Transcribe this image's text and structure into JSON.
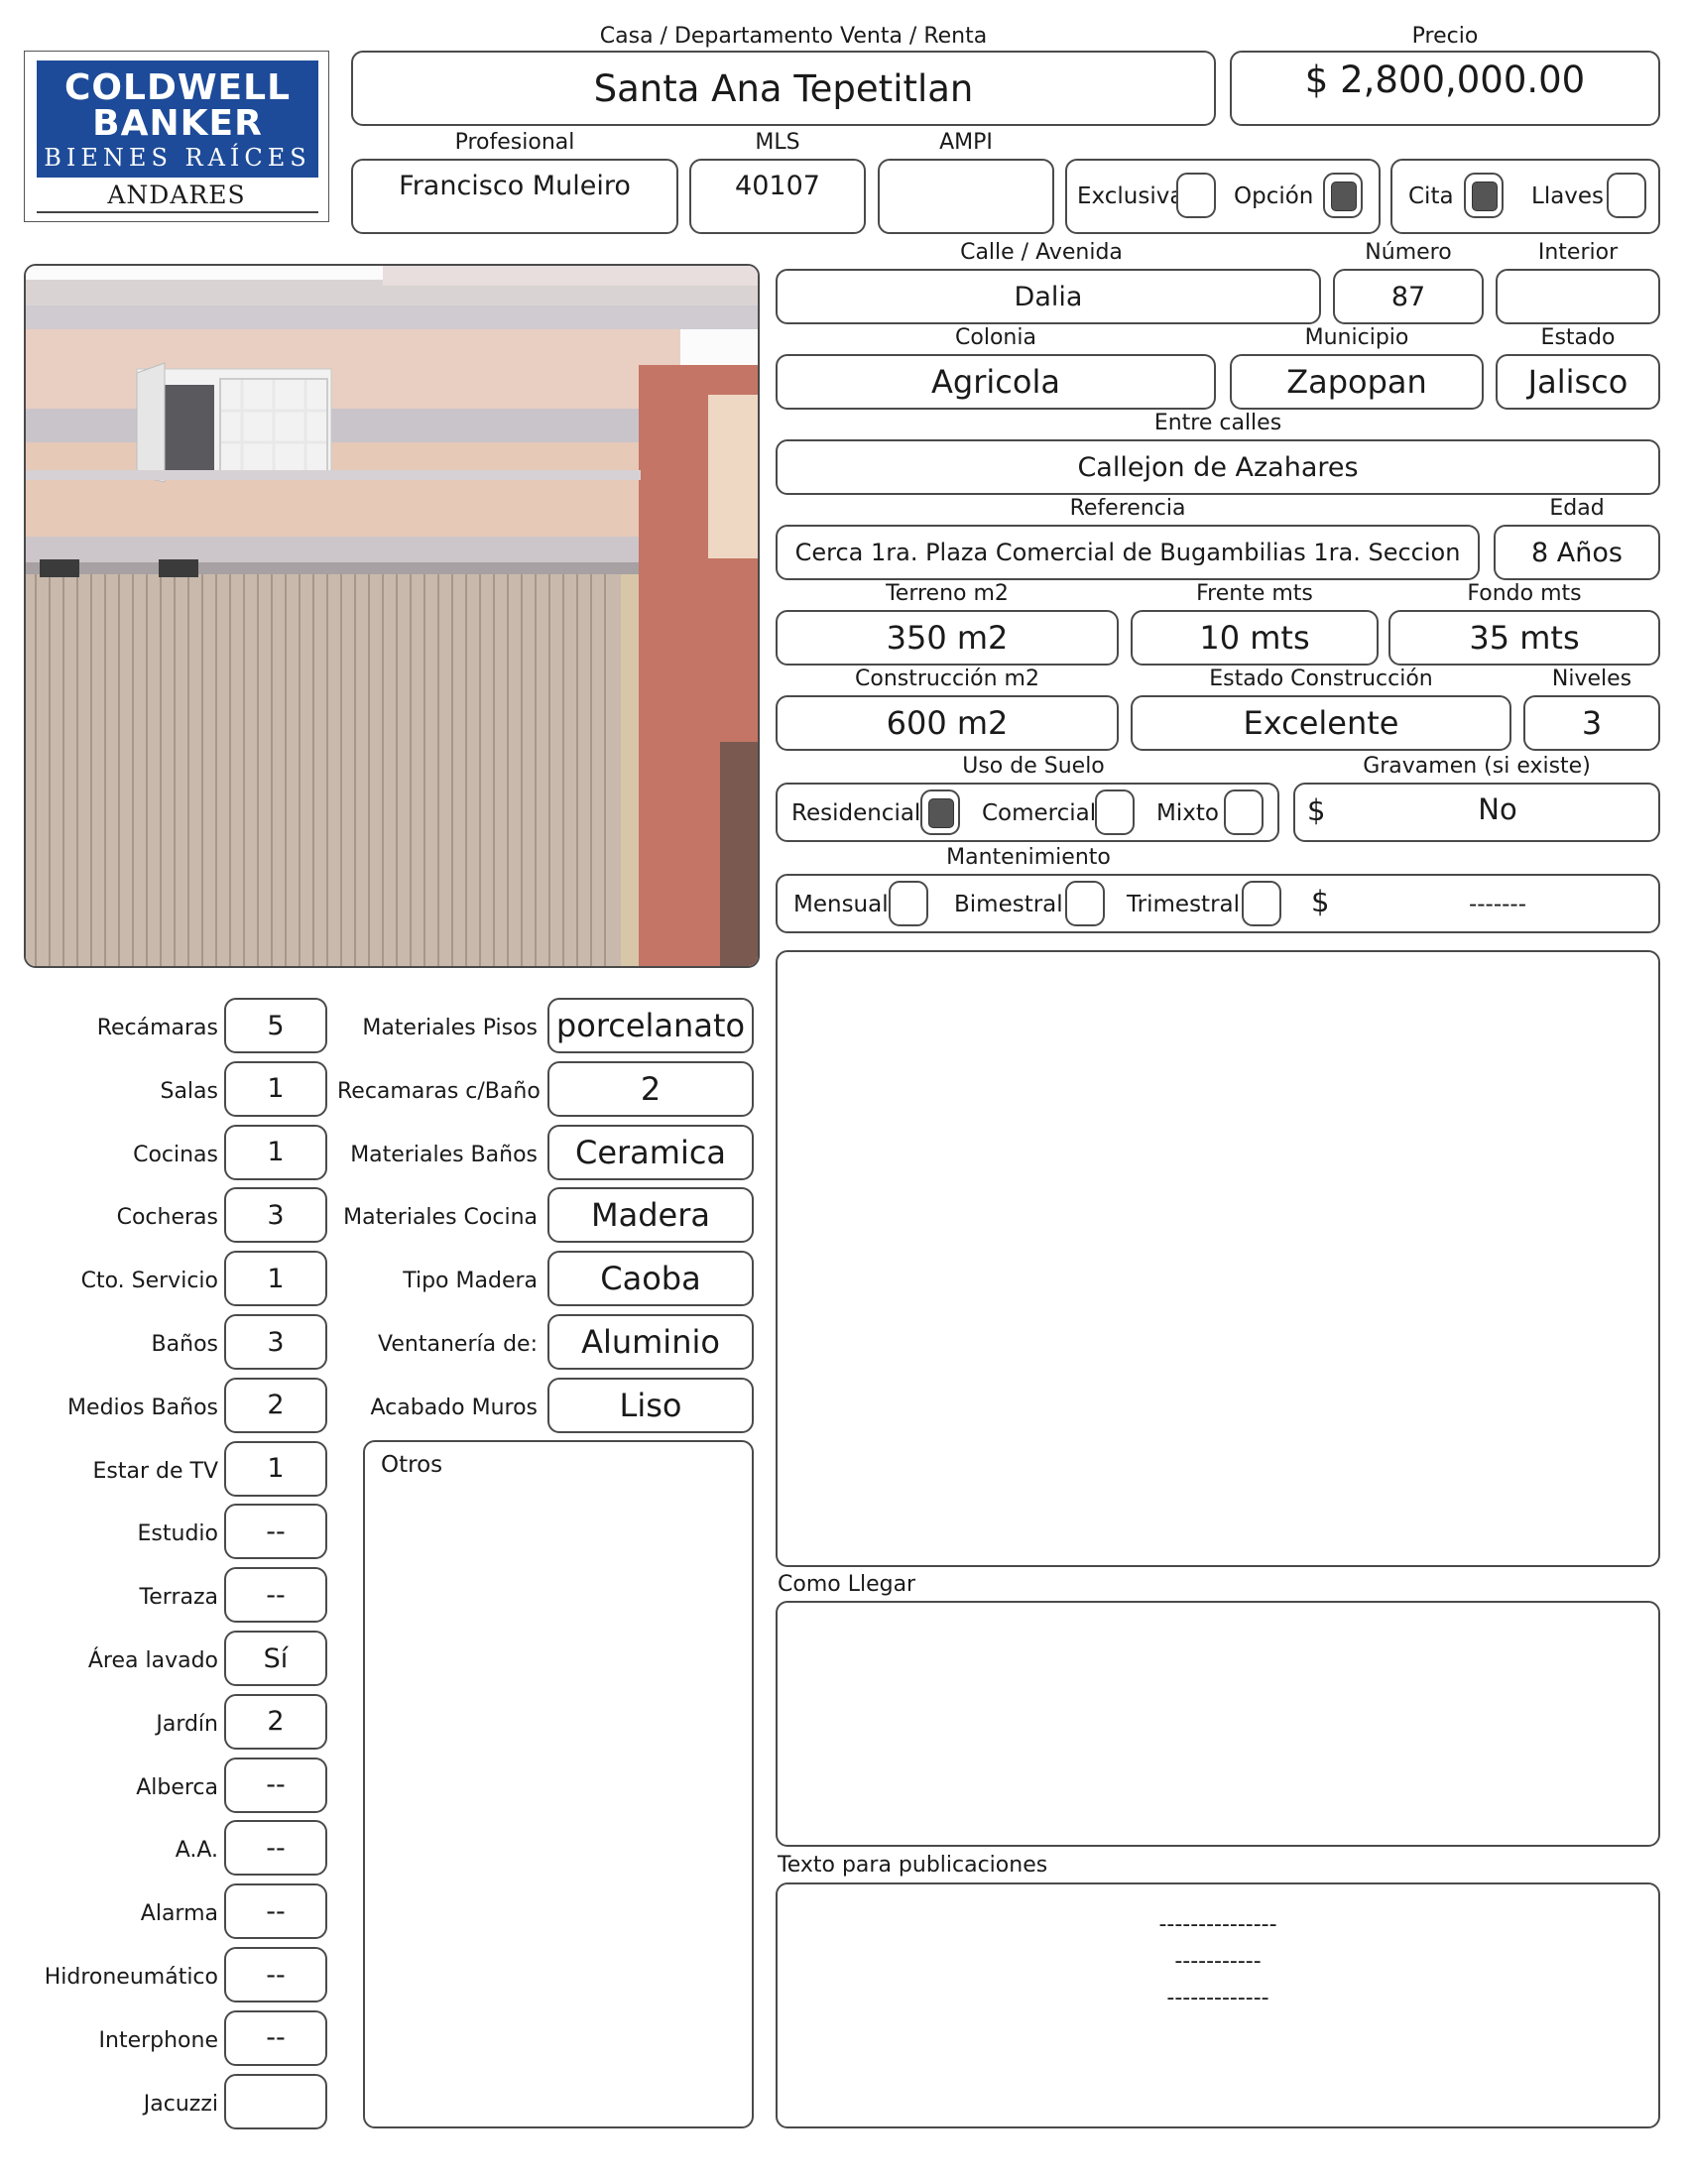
{
  "logo": {
    "line1": "COLDWELL",
    "line2": "BANKER",
    "line3": "BIENES RAÍCES",
    "sub": "ANDARES",
    "brand_color": "#1d4b99"
  },
  "header": {
    "type_label": "Casa / Departamento   Venta / Renta",
    "title": "Santa Ana Tepetitlan",
    "price_label": "Precio",
    "price": "$ 2,800,000.00"
  },
  "agent": {
    "profesional_label": "Profesional",
    "profesional": "Francisco Muleiro",
    "mls_label": "MLS",
    "mls": "40107",
    "ampi_label": "AMPI",
    "ampi": ""
  },
  "flags": {
    "exclusiva_label": "Exclusiva",
    "exclusiva": false,
    "opcion_label": "Opción",
    "opcion": true,
    "cita_label": "Cita",
    "cita": true,
    "llaves_label": "Llaves",
    "llaves": false
  },
  "address": {
    "calle_label": "Calle / Avenida",
    "calle": "Dalia",
    "numero_label": "Número",
    "numero": "87",
    "interior_label": "Interior",
    "interior": "",
    "colonia_label": "Colonia",
    "colonia": "Agricola",
    "municipio_label": "Municipio",
    "municipio": "Zapopan",
    "estado_label": "Estado",
    "estado": "Jalisco",
    "entre_label": "Entre calles",
    "entre": "Callejon de Azahares",
    "referencia_label": "Referencia",
    "referencia": "Cerca 1ra. Plaza Comercial de Bugambilias 1ra. Seccion",
    "edad_label": "Edad",
    "edad": "8 Años"
  },
  "dimensions": {
    "terreno_label": "Terreno m2",
    "terreno": "350 m2",
    "frente_label": "Frente mts",
    "frente": "10 mts",
    "fondo_label": "Fondo mts",
    "fondo": "35 mts",
    "construccion_label": "Construcción m2",
    "construccion": "600 m2",
    "estado_con_label": "Estado Construcción",
    "estado_con": "Excelente",
    "niveles_label": "Niveles",
    "niveles": "3"
  },
  "uso": {
    "label": "Uso de Suelo",
    "residencial_label": "Residencial",
    "residencial": true,
    "comercial_label": "Comercial",
    "comercial": false,
    "mixto_label": "Mixto",
    "mixto": false,
    "gravamen_label": "Gravamen (si existe)",
    "gravamen_currency": "$",
    "gravamen": "No"
  },
  "mantenimiento": {
    "label": "Mantenimiento",
    "mensual_label": "Mensual",
    "mensual": false,
    "bimestral_label": "Bimestral",
    "bimestral": false,
    "trimestral_label": "Trimestral",
    "trimestral": false,
    "currency": "$",
    "amount": "-------"
  },
  "features": [
    {
      "label": "Recámaras",
      "value": "5"
    },
    {
      "label": "Salas",
      "value": "1"
    },
    {
      "label": "Cocinas",
      "value": "1"
    },
    {
      "label": "Cocheras",
      "value": "3"
    },
    {
      "label": "Cto. Servicio",
      "value": "1"
    },
    {
      "label": "Baños",
      "value": "3"
    },
    {
      "label": "Medios Baños",
      "value": "2"
    },
    {
      "label": "Estar de TV",
      "value": "1"
    },
    {
      "label": "Estudio",
      "value": "--"
    },
    {
      "label": "Terraza",
      "value": "--"
    },
    {
      "label": "Área lavado",
      "value": "Sí"
    },
    {
      "label": "Jardín",
      "value": "2"
    },
    {
      "label": "Alberca",
      "value": "--"
    },
    {
      "label": "A.A.",
      "value": "--"
    },
    {
      "label": "Alarma",
      "value": "--"
    },
    {
      "label": "Hidroneumático",
      "value": "--"
    },
    {
      "label": "Interphone",
      "value": "--"
    },
    {
      "label": "Jacuzzi",
      "value": ""
    }
  ],
  "materials": [
    {
      "label": "Materiales Pisos",
      "value": "porcelanato"
    },
    {
      "label": "Recamaras c/Baño",
      "value": "2"
    },
    {
      "label": "Materiales Baños",
      "value": "Ceramica"
    },
    {
      "label": "Materiales Cocina",
      "value": "Madera"
    },
    {
      "label": "Tipo Madera",
      "value": "Caoba"
    },
    {
      "label": "Ventanería de:",
      "value": "Aluminio"
    },
    {
      "label": "Acabado Muros",
      "value": "Liso"
    }
  ],
  "otros_label": "Otros",
  "como_llegar_label": "Como Llegar",
  "texto_label": "Texto para publicaciones",
  "texto_lines": [
    "---------------",
    "-----------",
    "-------------"
  ]
}
